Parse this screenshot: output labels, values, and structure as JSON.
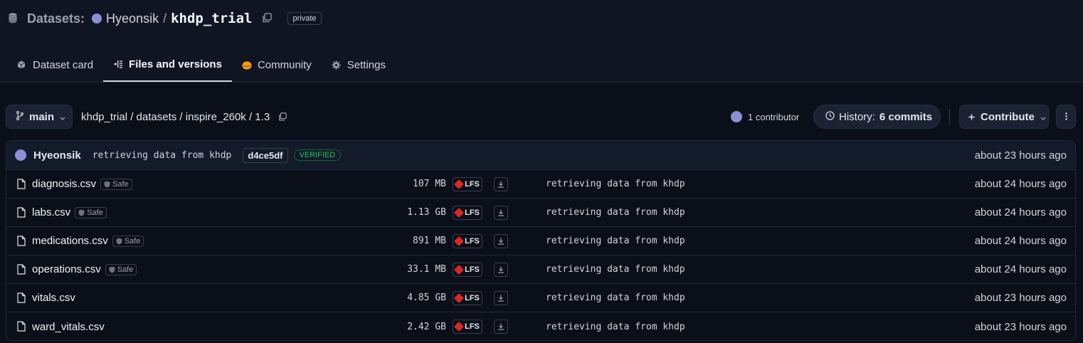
{
  "header": {
    "section_label": "Datasets:",
    "owner": "Hyeonsik",
    "slash": "/",
    "repo": "khdp_trial",
    "visibility": "private"
  },
  "tabs": [
    {
      "label": "Dataset card",
      "icon": "cube-icon",
      "active": false
    },
    {
      "label": "Files and versions",
      "icon": "files-icon",
      "active": true
    },
    {
      "label": "Community",
      "icon": "community-emoji-icon",
      "active": false
    },
    {
      "label": "Settings",
      "icon": "gear-icon",
      "active": false
    }
  ],
  "toolbar": {
    "branch": "main",
    "path": "khdp_trial / datasets / inspire_260k / 1.3",
    "contributors": "1 contributor",
    "history_label": "History:",
    "history_count": "6 commits",
    "contribute": "Contribute"
  },
  "last_commit": {
    "author": "Hyeonsik",
    "message": "retrieving data from khdp",
    "hash": "d4ce5df",
    "verified": "VERIFIED",
    "time": "about 23 hours ago"
  },
  "files": [
    {
      "name": "diagnosis.csv",
      "safe": "Safe",
      "size": "107 MB",
      "lfs": "LFS",
      "message": "retrieving data from khdp",
      "time": "about 24 hours ago"
    },
    {
      "name": "labs.csv",
      "safe": "Safe",
      "size": "1.13 GB",
      "lfs": "LFS",
      "message": "retrieving data from khdp",
      "time": "about 24 hours ago"
    },
    {
      "name": "medications.csv",
      "safe": "Safe",
      "size": "891 MB",
      "lfs": "LFS",
      "message": "retrieving data from khdp",
      "time": "about 24 hours ago"
    },
    {
      "name": "operations.csv",
      "safe": "Safe",
      "size": "33.1 MB",
      "lfs": "LFS",
      "message": "retrieving data from khdp",
      "time": "about 24 hours ago"
    },
    {
      "name": "vitals.csv",
      "safe": "",
      "size": "4.85 GB",
      "lfs": "LFS",
      "message": "retrieving data from khdp",
      "time": "about 23 hours ago"
    },
    {
      "name": "ward_vitals.csv",
      "safe": "",
      "size": "2.42 GB",
      "lfs": "LFS",
      "message": "retrieving data from khdp",
      "time": "about 23 hours ago"
    }
  ]
}
